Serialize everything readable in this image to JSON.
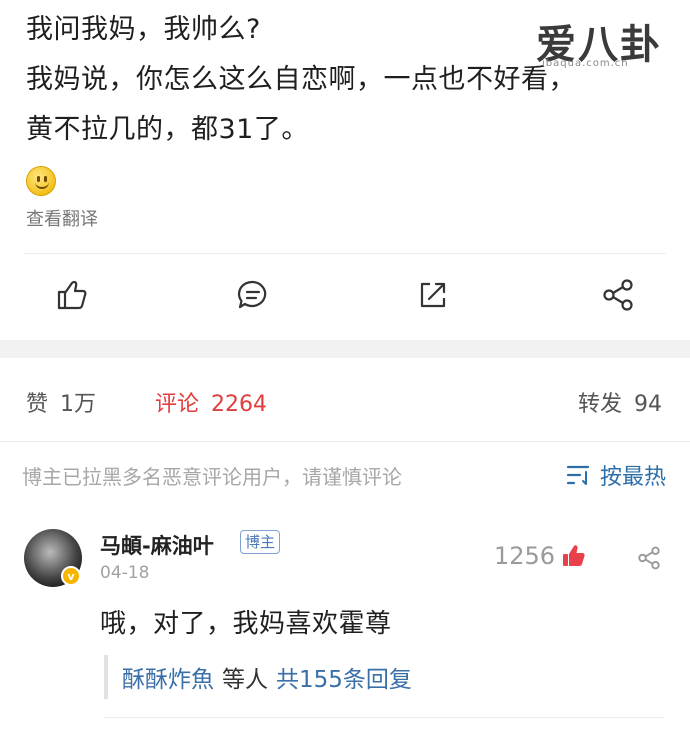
{
  "post": {
    "line1": "我问我妈，我帅么?",
    "line2": "我妈说，你怎么这么自恋啊，一点也不好看，",
    "line3": "黄不拉几的，都31了。",
    "emoji_icon": "smiley-emoji",
    "translate_label": "查看翻译"
  },
  "watermark": {
    "text": "爱八卦",
    "sub": "ibaqua.com.cn"
  },
  "actions": {
    "like_icon": "thumb-up-icon",
    "comment_icon": "comment-icon",
    "repost_icon": "repost-icon",
    "share_icon": "share-icon"
  },
  "stats": {
    "like_label": "赞",
    "like_count": "1万",
    "comment_label": "评论",
    "comment_count": "2264",
    "repost_label": "转发",
    "repost_count": "94",
    "active_color": "#e03d3d"
  },
  "notice": {
    "text": "博主已拉黑多名恶意评论用户，请谨慎评论",
    "sort_label": "按最热",
    "sort_icon": "sort-icon"
  },
  "comment": {
    "username": "马頔-麻油叶",
    "tag": "博主",
    "date": "04-18",
    "likes": "1256",
    "text": "哦，对了，我妈喜欢霍尊",
    "reply": {
      "name": "酥酥炸魚",
      "middle": "等人",
      "count_label": "共155条回复"
    }
  }
}
